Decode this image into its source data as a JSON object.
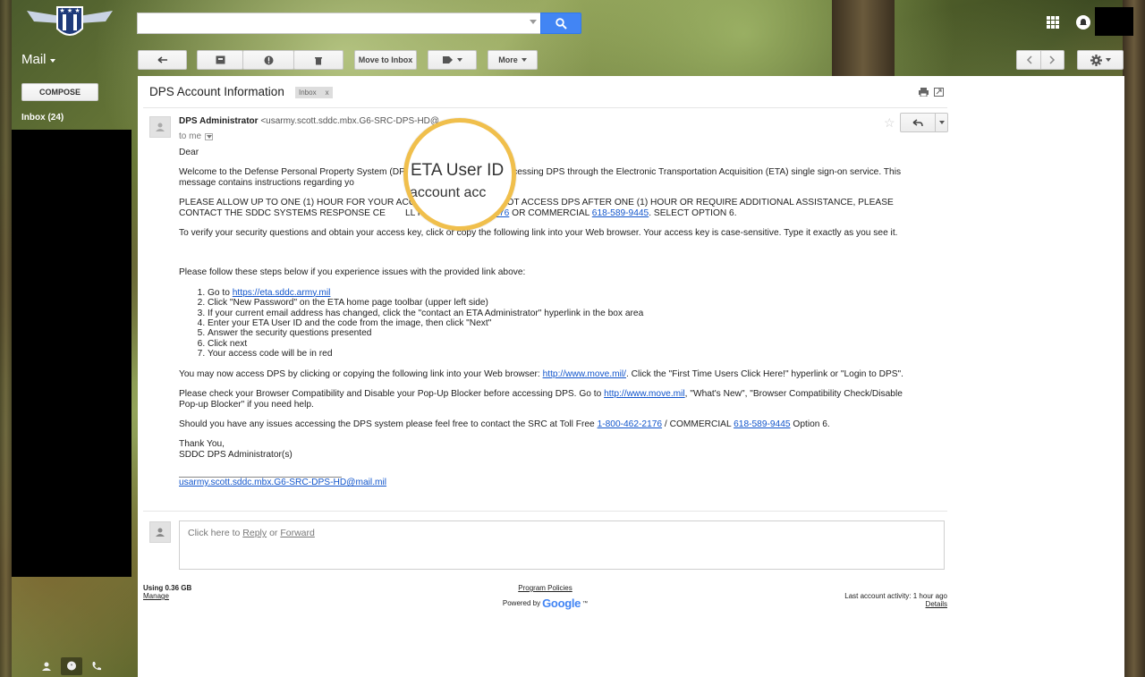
{
  "header": {
    "search_placeholder": "",
    "account_box_color": "#000000"
  },
  "toolbar": {
    "mail_label": "Mail",
    "move_to_inbox_label": "Move to Inbox",
    "more_label": "More"
  },
  "sidebar": {
    "compose_label": "COMPOSE",
    "inbox_label": "Inbox (24)"
  },
  "message": {
    "subject": "DPS Account Information",
    "tag": "Inbox",
    "tag_close": "x",
    "sender_name": "DPS Administrator",
    "sender_email": "<usarmy.scott.sddc.mbx.G6-SRC-DPS-HD@",
    "to": "to me",
    "greeting": "Dear",
    "para1_a": "Welcome to the Defense Personal Property System (DPS",
    "para1_b": "You will be accessing DPS through the Electronic Transportation Acquisition (ETA) single sign-on service. This message contains instructions regarding yo",
    "para2_a": "PLEASE ALLOW UP TO ONE (1) HOUR FOR YOUR ACC",
    "para2_b": "ED. IF YOU CANNOT ACCESS DPS AFTER ONE (1) HOUR OR REQUIRE ADDITIONAL ASSISTANCE, PLEASE CONTACT THE SDDC SYSTEMS RESPONSE CE",
    "para2_c": "LL FREE",
    "phone_tollfree": "1-800-462-2176",
    "para2_d": "OR COMMERCIAL",
    "phone_commercial": "618-589-9445",
    "para2_e": ".  SELECT OPTION 6.",
    "para3": "To verify your security questions and obtain your access key, click or copy the following link into your Web browser. Your access key is case-sensitive. Type it exactly as you see it.",
    "para4": "Please follow these steps below if you experience issues with the provided link above:",
    "step1_a": "Go to",
    "step1_link": "https://eta.sddc.army.mil",
    "step2": "Click \"New Password\" on the ETA home page toolbar (upper left side)",
    "step3": "If your current email address has changed, click the \"contact an ETA Administrator\" hyperlink in the box area",
    "step4": "Enter your ETA User ID and the code from the image, then click \"Next\"",
    "step5": "Answer the security questions presented",
    "step6": "Click next",
    "step7": "Your access code will be in red",
    "para5_a": "You may now access DPS by clicking or copying the following link into your Web browser:",
    "move_link": "http://www.move.mil/",
    "para5_b": ". Click the \"First Time Users Click Here!\" hyperlink or \"Login to DPS\".",
    "para6_a": "Please check your Browser Compatibility and Disable your Pop-Up Blocker before accessing DPS.  Go to",
    "move_link2": "http://www.move.mil",
    "para6_b": ", \"What's New\", \"Browser Compatibility Check/Disable Pop-up Blocker\" if you need help.",
    "para7_a": "Should you have any issues accessing the DPS system please feel free to contact the SRC at Toll Free",
    "para7_phone1": "1-800-462-2176",
    "para7_b": "/ COMMERCIAL",
    "para7_phone2": "618-589-9445",
    "para7_c": "Option 6.",
    "signoff": "Thank You,",
    "signature": "SDDC DPS Administrator(s)",
    "sig_email": "usarmy.scott.sddc.mbx.G6-SRC-DPS-HD@mail.mil",
    "magnifier_line1": "ETA User ID",
    "magnifier_line2": "account acc"
  },
  "reply": {
    "prompt_a": "Click here to",
    "reply_link": "Reply",
    "or": "or",
    "forward_link": "Forward"
  },
  "footer": {
    "usage": "Using 0.36 GB",
    "manage": "Manage",
    "program_policies": "Program Policies",
    "powered_by": "Powered by",
    "google": "Google",
    "tm": "™",
    "last_activity": "Last account activity: 1 hour ago",
    "details": "Details"
  },
  "colors": {
    "search_blue": "#4285f4",
    "link_blue": "#1155cc",
    "magnifier_ring": "#f0bf4c"
  }
}
